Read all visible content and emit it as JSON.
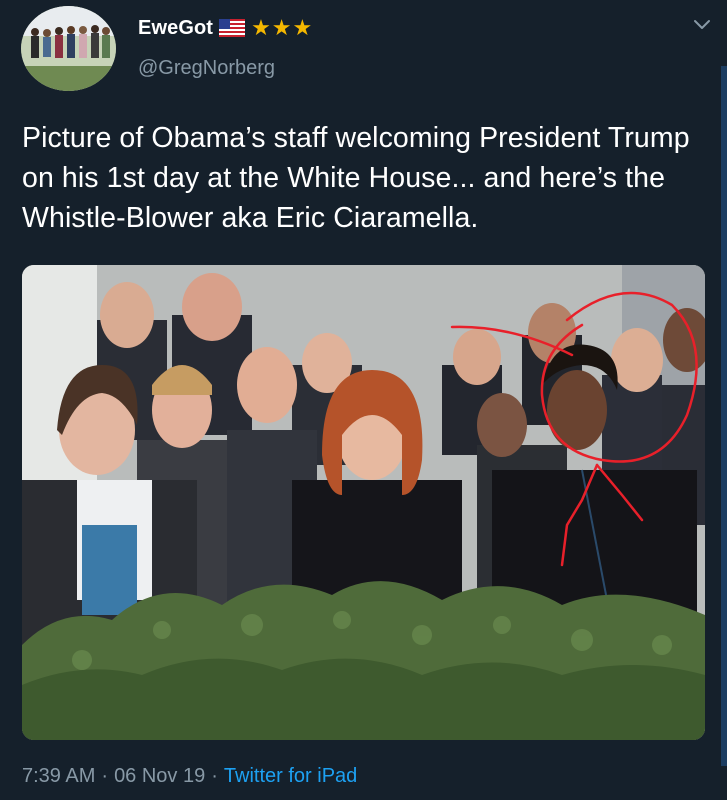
{
  "author": {
    "display_name": "EweGot",
    "handle": "@GregNorberg",
    "badges": [
      "us-flag-icon",
      "star-icon",
      "star-icon",
      "star-icon"
    ]
  },
  "tweet": {
    "text": "Picture of Obama’s staff welcoming President Trump on his 1st day at the White House... and here’s the Whistle-Blower aka Eric Ciaramella."
  },
  "meta": {
    "time": "7:39 AM",
    "date": "06 Nov 19",
    "separator": "·",
    "source": "Twitter for iPad"
  },
  "colors": {
    "background": "#15202b",
    "secondary_text": "#8899a6",
    "link": "#1da1f2",
    "star": "#f5b800",
    "annotation_red": "#e8202a"
  },
  "media": {
    "kind": "photo",
    "annotation": "red circle-and-arrow drawing"
  }
}
